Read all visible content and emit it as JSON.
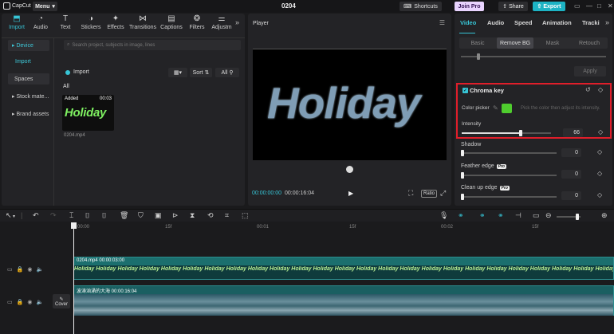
{
  "titlebar": {
    "app_name": "CapCut",
    "menu_label": "Menu",
    "project_title": "0204",
    "shortcuts_label": "Shortcuts",
    "join_pro_label": "Join Pro",
    "share_label": "Share",
    "export_label": "Export"
  },
  "media_tabs": [
    {
      "label": "Import",
      "icon": "import-icon"
    },
    {
      "label": "Audio",
      "icon": "audio-icon"
    },
    {
      "label": "Text",
      "icon": "text-icon"
    },
    {
      "label": "Stickers",
      "icon": "stickers-icon"
    },
    {
      "label": "Effects",
      "icon": "effects-icon"
    },
    {
      "label": "Transitions",
      "icon": "transitions-icon"
    },
    {
      "label": "Captions",
      "icon": "captions-icon"
    },
    {
      "label": "Filters",
      "icon": "filters-icon"
    },
    {
      "label": "Adjustm",
      "icon": "adjust-icon"
    }
  ],
  "side_nav": {
    "device": "Device",
    "import": "Import",
    "spaces": "Spaces",
    "stock": "Stock mate...",
    "brand": "Brand assets"
  },
  "media": {
    "search_placeholder": "Search project, subjects in image, lines",
    "import_label": "Import",
    "sort_label": "Sort",
    "all_filter_label": "All",
    "all_heading": "All",
    "thumb_badge": "Added",
    "thumb_duration": "00:03",
    "thumb_text": "Holiday",
    "thumb_filename": "0204.mp4"
  },
  "player": {
    "title": "Player",
    "overlay_text": "Holiday",
    "current_time": "00:00:00:00",
    "total_time": "00:00:16:04",
    "ratio_label": "Ratio"
  },
  "inspector": {
    "tabs": [
      "Video",
      "Audio",
      "Speed",
      "Animation",
      "Tracki"
    ],
    "sub_tabs": [
      "Basic",
      "Remove BG",
      "Mask",
      "Retouch"
    ],
    "apply_label": "Apply",
    "chroma_title": "Chroma key",
    "color_picker_label": "Color picker",
    "color_picker_hint": "Pick the color then adjust its intensity.",
    "picked_color": "#4fcd2e",
    "intensity_label": "Intensity",
    "intensity_value": "66",
    "intensity_level": 0.66,
    "shadow_label": "Shadow",
    "shadow_value": "0",
    "feather_label": "Feather edge",
    "feather_value": "0",
    "cleanup_label": "Clean up edge",
    "cleanup_value": "0",
    "pro_tag": "Pro"
  },
  "timeline": {
    "ruler": [
      "00:00",
      "15f",
      "00:01",
      "15f",
      "00:02",
      "15f"
    ],
    "clip1_name": "0204.mp4  00:00:03:00",
    "clip1_strip": "Holiday Holiday Holiday Holiday Holiday Holiday Holiday Holiday Holiday Holiday Holiday Holiday Holiday Holiday Holiday Holiday Holiday Holiday Holiday Holiday Holiday Holiday Holiday Holiday Holiday",
    "clip2_name": "波涛汹涌的大海  00:00:16:04",
    "cover_label": "Cover"
  },
  "colors": {
    "accent": "#37c5d6",
    "highlight_box": "#e01e2a",
    "export": "#1db3c4"
  }
}
